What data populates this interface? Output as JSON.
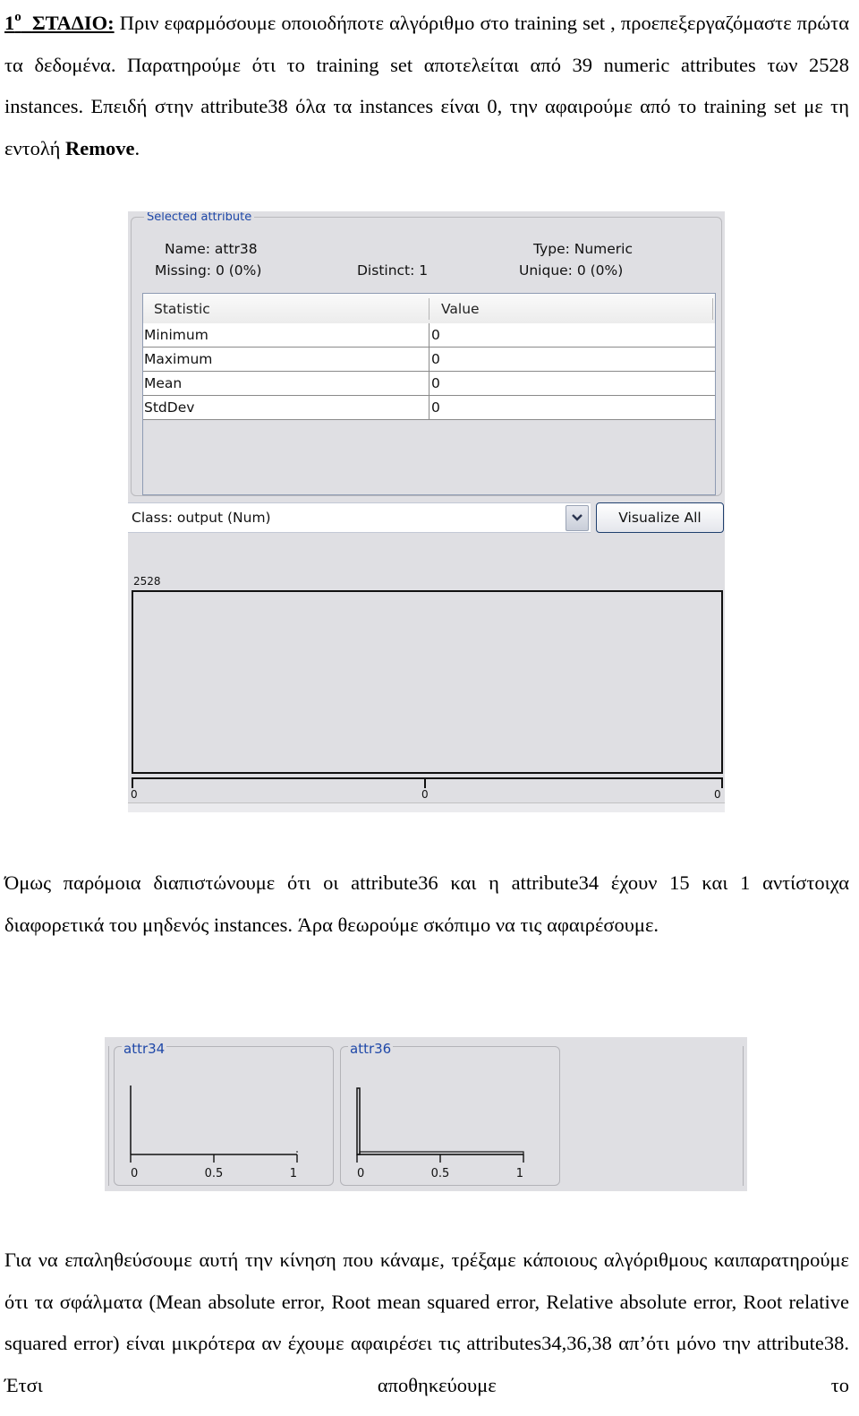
{
  "intro": {
    "stage_number": "1",
    "stage_sup": "ο",
    "stage_label": "ΣΤΑΔΙΟ:",
    "lines": [
      " Πριν εφαρμόσουμε οποιοδήποτε αλγόριθμο στο training set , προεπεξεργαζόμαστε πρώτα τα δεδομένα. Παρατηρούμε ότι το training set αποτελείται από 39 numeric attributes των 2528 instances. Επειδή στην attribute38 όλα τα instances είναι 0, την αφαιρούμε από το training set με τη  εντολή "
    ],
    "command": "Remove",
    "end": "."
  },
  "weka_attribute_panel": {
    "group_title": "Selected attribute",
    "name_label": "Name: attr38",
    "type_label": "Type: Numeric",
    "missing_label": "Missing: 0 (0%)",
    "distinct_label": "Distinct: 1",
    "unique_label": "Unique: 0 (0%)",
    "table": {
      "headers": [
        "Statistic",
        "Value"
      ],
      "rows": [
        {
          "statistic": "Minimum",
          "value": "0"
        },
        {
          "statistic": "Maximum",
          "value": "0"
        },
        {
          "statistic": "Mean",
          "value": "0"
        },
        {
          "statistic": "StdDev",
          "value": "0"
        }
      ]
    },
    "class_select_value": "Class: output (Num)",
    "visualize_all_label": "Visualize All",
    "histogram": {
      "max_count": "2528",
      "tick_labels": [
        "0",
        "0",
        "0"
      ]
    }
  },
  "paragraph2": "Όμως παρόμοια διαπιστώνουμε ότι οι attribute36 και η attribute34 έχουν 15 και 1 αντίστοιχα διαφορετικά του μηδενός instances. Άρα θεωρούμε σκόπιμο να τις αφαιρέσουμε.",
  "mini_histograms": [
    {
      "title": "attr34",
      "tick_labels": [
        "0",
        "0.5",
        "1"
      ],
      "nonzero_instances": 1
    },
    {
      "title": "attr36",
      "tick_labels": [
        "0",
        "0.5",
        "1"
      ],
      "nonzero_instances": 15
    }
  ],
  "paragraph3": "Για να επαληθεύσουμε αυτή την κίνηση που κάναμε, τρέξαμε κάποιους αλγόριθμους καιπαρατηρούμε ότι τα σφάλματα  (Mean absolute error, Root mean squared error, Relative absolute error,  Root relative squared error) είναι μικρότερα αν έχουμε αφαιρέσει τις attributes34,36,38 απ’ότι μόνο την attribute38. Έτσι αποθηκεύουμε το"
}
